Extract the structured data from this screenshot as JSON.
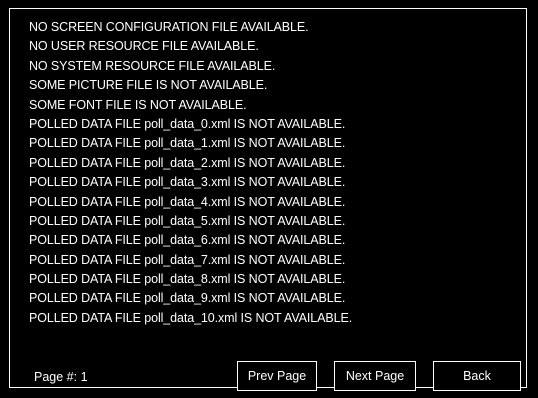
{
  "messages": [
    "NO SCREEN CONFIGURATION FILE AVAILABLE.",
    "NO USER RESOURCE FILE AVAILABLE.",
    "NO SYSTEM RESOURCE FILE AVAILABLE.",
    "SOME PICTURE FILE IS NOT AVAILABLE.",
    "SOME FONT FILE IS NOT AVAILABLE.",
    "POLLED DATA FILE poll_data_0.xml IS NOT AVAILABLE.",
    "POLLED DATA FILE poll_data_1.xml IS NOT AVAILABLE.",
    "POLLED DATA FILE poll_data_2.xml IS NOT AVAILABLE.",
    "POLLED DATA FILE poll_data_3.xml IS NOT AVAILABLE.",
    "POLLED DATA FILE poll_data_4.xml IS NOT AVAILABLE.",
    "POLLED DATA FILE poll_data_5.xml IS NOT AVAILABLE.",
    "POLLED DATA FILE poll_data_6.xml IS NOT AVAILABLE.",
    "POLLED DATA FILE poll_data_7.xml IS NOT AVAILABLE.",
    "POLLED DATA FILE poll_data_8.xml IS NOT AVAILABLE.",
    "POLLED DATA FILE poll_data_9.xml IS NOT AVAILABLE.",
    "POLLED DATA FILE poll_data_10.xml IS NOT AVAILABLE."
  ],
  "footer": {
    "page_label": "Page #: 1",
    "prev_label": "Prev Page",
    "next_label": "Next Page",
    "back_label": "Back"
  },
  "colors": {
    "background": "#000000",
    "foreground": "#ffffff"
  }
}
